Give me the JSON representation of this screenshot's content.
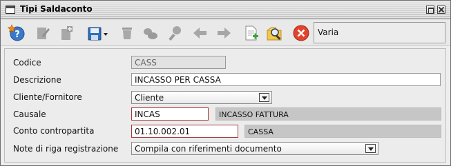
{
  "window": {
    "title": "Tipi Saldaconto"
  },
  "toolbar": {
    "status_text": "Varia",
    "icons": [
      "new-icon",
      "edit-icon",
      "duplicate-icon",
      "save-icon",
      "delete-icon",
      "copy-icon",
      "search-icon",
      "previous-icon",
      "next-icon",
      "export-icon",
      "find-icon",
      "close-icon"
    ]
  },
  "form": {
    "codice": {
      "label": "Codice",
      "value": "CASS"
    },
    "descrizione": {
      "label": "Descrizione",
      "value": "INCASSO PER CASSA"
    },
    "cliente_fornitore": {
      "label": "Cliente/Fornitore",
      "value": "Cliente"
    },
    "causale": {
      "label": "Causale",
      "value": "INCAS",
      "description": "INCASSO FATTURA"
    },
    "conto_contropartita": {
      "label": "Conto contropartita",
      "value": "01.10.002.01",
      "description": "CASSA"
    },
    "note_riga": {
      "label": "Note di riga registrazione",
      "value": "Compila con riferimenti documento"
    }
  },
  "colors": {
    "title_bar": "#d6d6d6",
    "window_bg": "#eeeeee",
    "error_border": "#a53a3a",
    "readonly_bg": "#c6c6c6"
  }
}
